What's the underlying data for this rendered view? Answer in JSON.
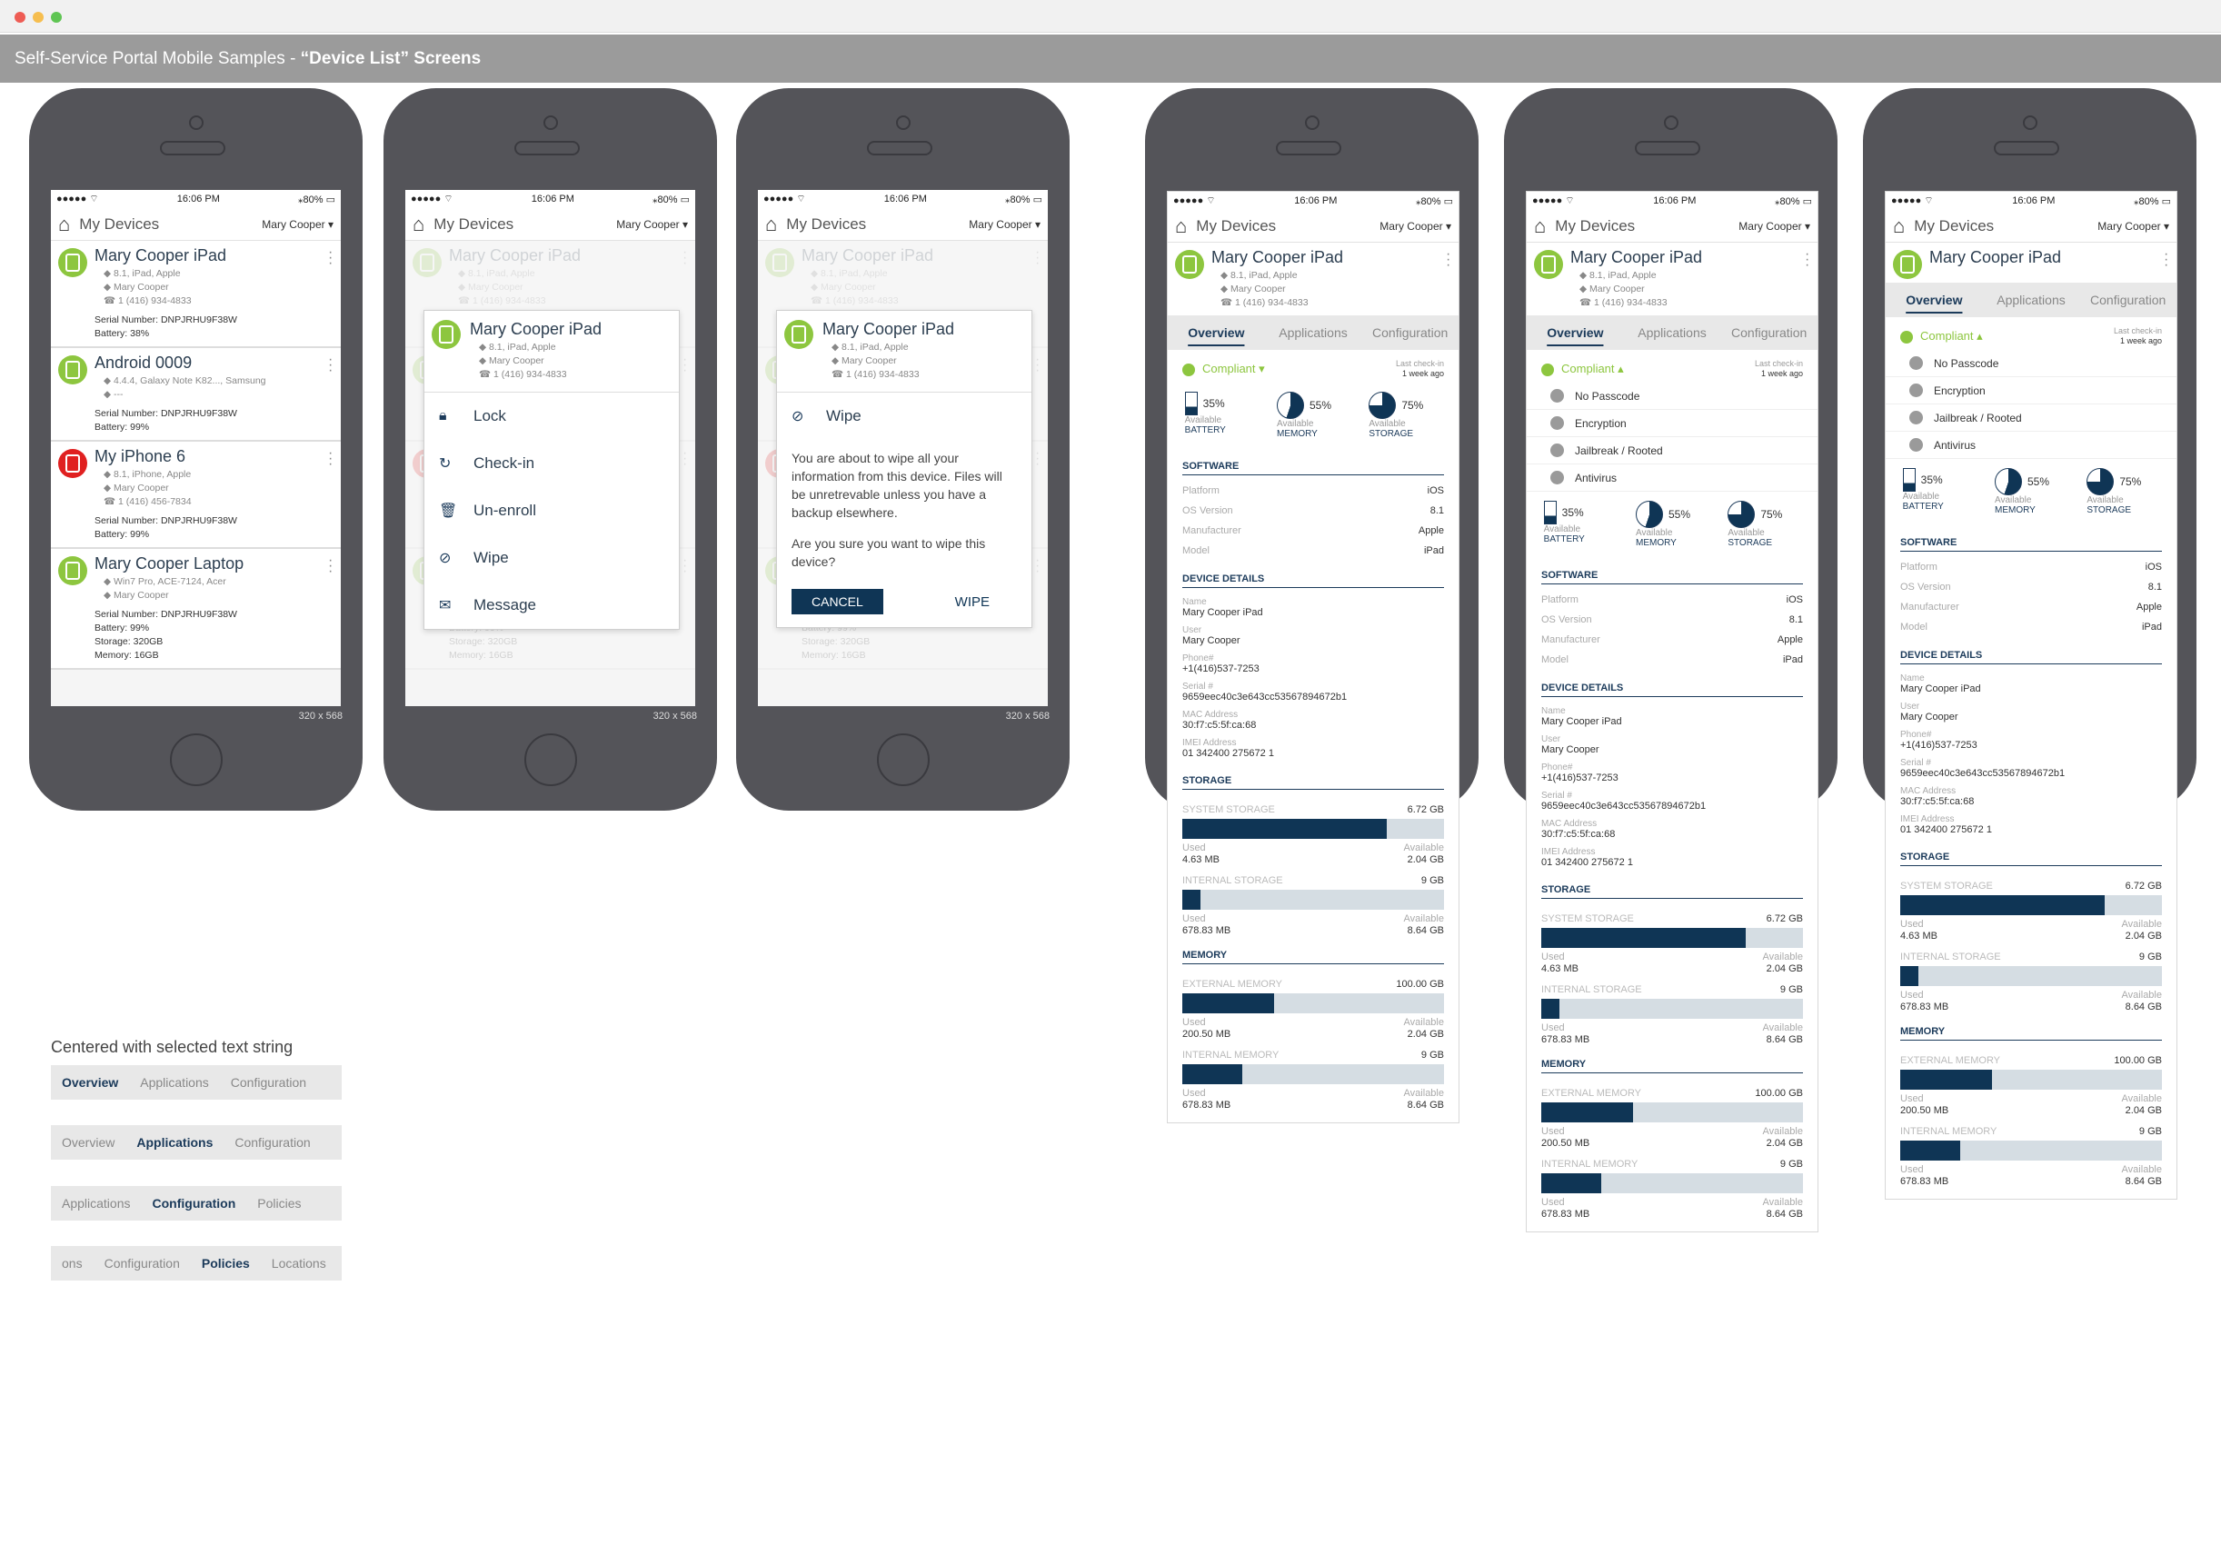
{
  "window": {
    "title_plain": "Self-Service Portal Mobile Samples - ",
    "title_bold": "“Device List” Screens"
  },
  "status": {
    "signal": "●●●●● ⌔",
    "time": "16:06 PM",
    "battery": "⁎80% ▭"
  },
  "appbar": {
    "title": "My Devices",
    "user": "Mary Cooper ▾"
  },
  "resolution": "320 x 568",
  "devices": [
    {
      "name": "Mary Cooper iPad",
      "os": "8.1,  iPad, Apple",
      "user": "Mary Cooper",
      "phone": "1 (416) 934-4833",
      "lines": [
        "Serial Number: DNPJRHU9F38W",
        "Battery: 38%"
      ]
    },
    {
      "name": "Android 0009",
      "os": "4.4.4, Galaxy Note K82..., Samsung",
      "user": "---",
      "phone": "",
      "lines": [
        "Serial Number: DNPJRHU9F38W",
        "Battery: 99%"
      ]
    },
    {
      "name": "My iPhone 6",
      "os": "8.1,  iPhone, Apple",
      "user": "Mary Cooper",
      "phone": "1 (416) 456-7834",
      "lines": [
        "Serial Number: DNPJRHU9F38W",
        "Battery: 99%"
      ]
    },
    {
      "name": "Mary Cooper Laptop",
      "os": "Win7 Pro, ACE-7124, Acer",
      "user": "Mary Cooper",
      "phone": "",
      "lines": [
        "Serial Number: DNPJRHU9F38W",
        "Battery: 99%",
        "Storage: 320GB",
        "Memory: 16GB"
      ]
    }
  ],
  "menu": [
    "Lock",
    "Check-in",
    "Un-enroll",
    "Wipe",
    "Message"
  ],
  "wipe": {
    "title": "Wipe",
    "text1": "You are about to wipe all your information from this device. Files will be unretrevable unless you have a backup elsewhere.",
    "text2": "Are you sure you want to wipe this device?",
    "cancel": "CANCEL",
    "confirm": "WIPE"
  },
  "detail": {
    "tabs": [
      "Overview",
      "Applications",
      "Configuration"
    ],
    "compliant": "Compliant",
    "lastcheck_label": "Last check-in",
    "lastcheck_value": "1 week ago",
    "checks": [
      "No Passcode",
      "Encryption",
      "Jailbreak / Rooted",
      "Antivirus"
    ],
    "gauges": [
      {
        "value": "35%",
        "label": "Available",
        "name": "BATTERY",
        "pct": 35
      },
      {
        "value": "55%",
        "label": "Available",
        "name": "MEMORY",
        "pct": 55
      },
      {
        "value": "75%",
        "label": "Available",
        "name": "STORAGE",
        "pct": 75
      }
    ],
    "software_title": "SOFTWARE",
    "software": [
      [
        "Platform",
        "iOS"
      ],
      [
        "OS Version",
        "8.1"
      ],
      [
        "Manufacturer",
        "Apple"
      ],
      [
        "Model",
        "iPad"
      ]
    ],
    "details_title": "DEVICE DETAILS",
    "details": [
      [
        "Name",
        "Mary Cooper iPad"
      ],
      [
        "User",
        "Mary Cooper"
      ],
      [
        "Phone#",
        "+1(416)537-7253"
      ],
      [
        "Serial #",
        "9659eec40c3e643cc53567894672b1"
      ],
      [
        "MAC Address",
        "30:f7:c5:5f:ca:68"
      ],
      [
        "IMEI Address",
        "01 342400 275672 1"
      ]
    ],
    "storage_title": "STORAGE",
    "storage": [
      {
        "label": "SYSTEM STORAGE",
        "total": "6.72 GB",
        "used_label": "Used",
        "used": "4.63 MB",
        "avail_label": "Available",
        "avail": "2.04 GB",
        "fill": 0.78
      },
      {
        "label": "INTERNAL STORAGE",
        "total": "9 GB",
        "used_label": "Used",
        "used": "678.83 MB",
        "avail_label": "Available",
        "avail": "8.64 GB",
        "fill": 0.07
      }
    ],
    "memory_title": "MEMORY",
    "memory": [
      {
        "label": "EXTERNAL MEMORY",
        "total": "100.00 GB",
        "used_label": "Used",
        "used": "200.50 MB",
        "avail_label": "Available",
        "avail": "2.04 GB",
        "fill": 0.35
      },
      {
        "label": "INTERNAL MEMORY",
        "total": "9 GB",
        "used_label": "Used",
        "used": "678.83 MB",
        "avail_label": "Available",
        "avail": "8.64 GB",
        "fill": 0.23
      }
    ]
  },
  "tabdemo": {
    "caption": "Centered with selected text string",
    "rows": [
      [
        "Overview",
        "Applications",
        "Configuration"
      ],
      [
        "Overview",
        "Applications",
        "Configuration"
      ],
      [
        "Applications",
        "Configuration",
        "Policies"
      ],
      [
        "ons",
        "Configuration",
        "Policies",
        "Locations"
      ]
    ],
    "selected": [
      0,
      1,
      1,
      2
    ]
  },
  "colors": {
    "accent": "#0f3555",
    "green": "#8dc63f",
    "red": "#e02020",
    "banner": "#9b9b9b"
  }
}
